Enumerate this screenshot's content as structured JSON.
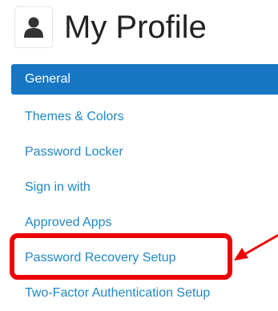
{
  "header": {
    "title": "My Profile",
    "icon": "user-icon"
  },
  "nav": {
    "items": [
      {
        "label": "General",
        "active": true
      },
      {
        "label": "Themes & Colors",
        "active": false
      },
      {
        "label": "Password Locker",
        "active": false
      },
      {
        "label": "Sign in with",
        "active": false
      },
      {
        "label": "Approved Apps",
        "active": false
      },
      {
        "label": "Password Recovery Setup",
        "active": false
      },
      {
        "label": "Two-Factor Authentication Setup",
        "active": false
      }
    ]
  },
  "colors": {
    "accent": "#1777c4",
    "link": "#1e88c7",
    "annotation": "#ee0000"
  }
}
